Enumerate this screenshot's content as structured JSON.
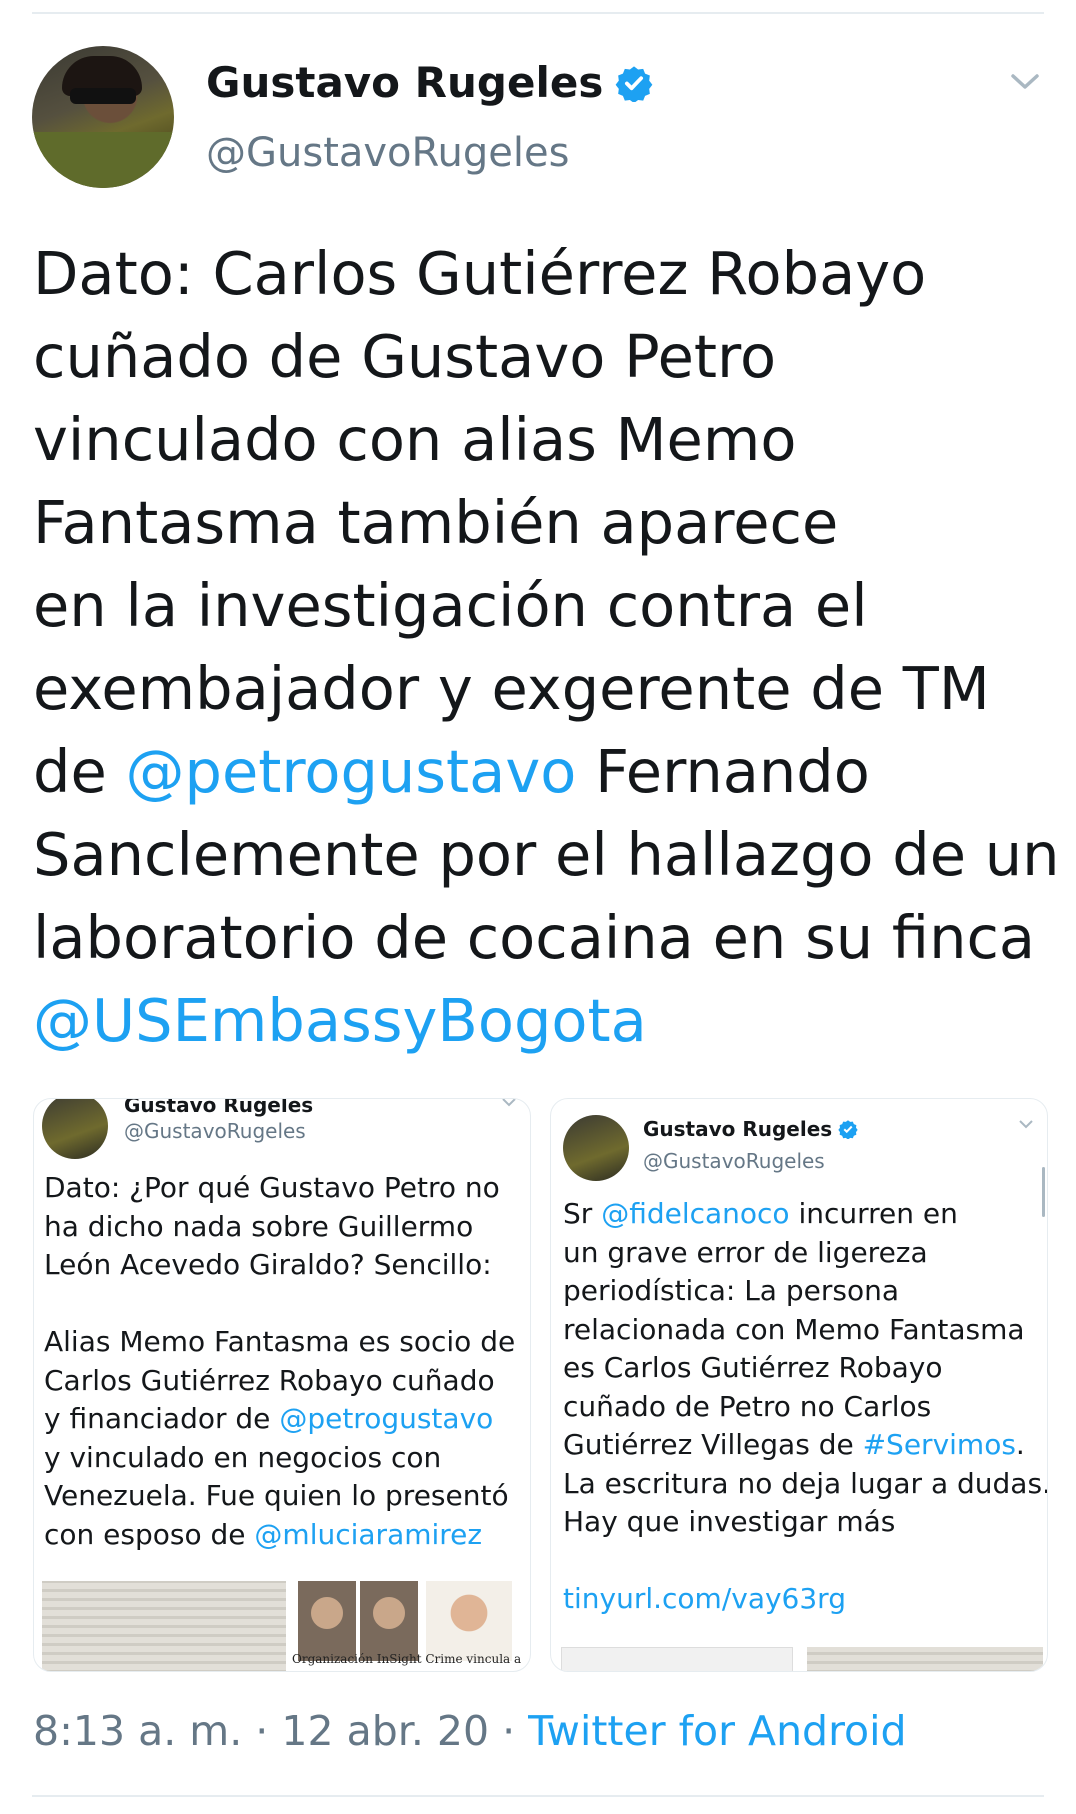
{
  "author": {
    "name": "Gustavo Rugeles",
    "handle": "@GustavoRugeles"
  },
  "tweet": {
    "lines": [
      [
        {
          "t": "Dato: Carlos Gutiérrez Robayo"
        }
      ],
      [
        {
          "t": "cuñado de Gustavo Petro"
        }
      ],
      [
        {
          "t": "vinculado con alias Memo"
        }
      ],
      [
        {
          "t": "Fantasma también aparece"
        }
      ],
      [
        {
          "t": "en la investigación contra el"
        }
      ],
      [
        {
          "t": "exembajador y exgerente de TM"
        }
      ],
      [
        {
          "t": "de "
        },
        {
          "t": "@petrogustavo",
          "mention": true
        },
        {
          "t": " Fernando"
        }
      ],
      [
        {
          "t": "Sanclemente por el hallazgo de un"
        }
      ],
      [
        {
          "t": "laboratorio de cocaina en su finca"
        }
      ],
      [
        {
          "t": "@USEmbassyBogota",
          "mention": true
        }
      ]
    ]
  },
  "embedded": [
    {
      "name": "Gustavo Rugeles",
      "handle": "@GustavoRugeles",
      "paragraphs": [
        [
          [
            {
              "t": "Dato: ¿Por qué Gustavo Petro no"
            }
          ],
          [
            {
              "t": "ha dicho nada sobre Guillermo"
            }
          ],
          [
            {
              "t": "León Acevedo Giraldo? Sencillo:"
            }
          ]
        ],
        [
          [
            {
              "t": "Alias Memo Fantasma es socio de"
            }
          ],
          [
            {
              "t": "Carlos Gutiérrez Robayo cuñado"
            }
          ],
          [
            {
              "t": "y financiador de "
            },
            {
              "t": "@petrogustavo",
              "mention": true
            }
          ],
          [
            {
              "t": "y vinculado en negocios con"
            }
          ],
          [
            {
              "t": "Venezuela. Fue quien lo presentó"
            }
          ],
          [
            {
              "t": "con esposo de "
            },
            {
              "t": "@mluciaramirez",
              "mention": true
            }
          ]
        ]
      ],
      "image_caption": "Organización InSight Crime vincula a"
    },
    {
      "name": "Gustavo Rugeles",
      "handle": "@GustavoRugeles",
      "paragraphs": [
        [
          [
            {
              "t": "Sr "
            },
            {
              "t": "@fidelcanoco",
              "mention": true
            },
            {
              "t": " incurren en"
            }
          ],
          [
            {
              "t": "un grave error de ligereza"
            }
          ],
          [
            {
              "t": "periodística: La persona"
            }
          ],
          [
            {
              "t": "relacionada con Memo Fantasma"
            }
          ],
          [
            {
              "t": "es Carlos Gutiérrez Robayo"
            }
          ],
          [
            {
              "t": "cuñado de Petro no Carlos"
            }
          ],
          [
            {
              "t": "Gutiérrez Villegas de "
            },
            {
              "t": "#Servimos",
              "mention": true
            },
            {
              "t": "."
            }
          ],
          [
            {
              "t": "La escritura no deja lugar a dudas."
            }
          ],
          [
            {
              "t": "Hay que investigar más"
            }
          ]
        ],
        [
          [
            {
              "t": "tinyurl.com/vay63rg",
              "mention": true
            }
          ]
        ]
      ],
      "image_caption": ""
    }
  ],
  "meta": {
    "time": "8:13 a. m.",
    "sep": " · ",
    "date": "12 abr. 20",
    "source": "Twitter for Android"
  },
  "colors": {
    "mention": "#1da1f2",
    "verified": "#1da1f2",
    "secondary_text": "#657786"
  },
  "icons": [
    "verified-badge-icon",
    "chevron-down-icon"
  ]
}
